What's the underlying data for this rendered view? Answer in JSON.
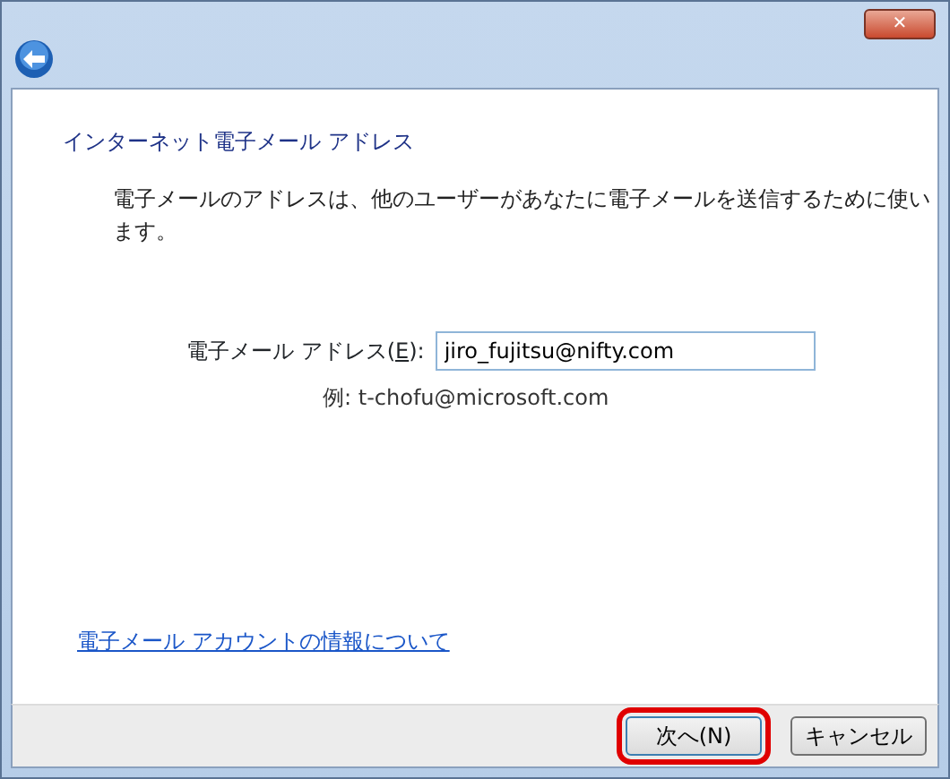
{
  "window": {
    "close_button": "✕"
  },
  "heading": "インターネット電子メール アドレス",
  "description": "電子メールのアドレスは、他のユーザーがあなたに電子メールを送信するために使います。",
  "email_field": {
    "label": {
      "before": "電子メール アドレス(",
      "key": "E",
      "after": "):"
    },
    "value": "jiro_fujitsu@nifty.com",
    "example": "例: t-chofu@microsoft.com"
  },
  "help_link": "電子メール アカウントの情報について",
  "buttons": [
    {
      "label": "次へ(N)",
      "highlighted": true
    },
    {
      "label": "キャンセル",
      "highlighted": false
    }
  ]
}
